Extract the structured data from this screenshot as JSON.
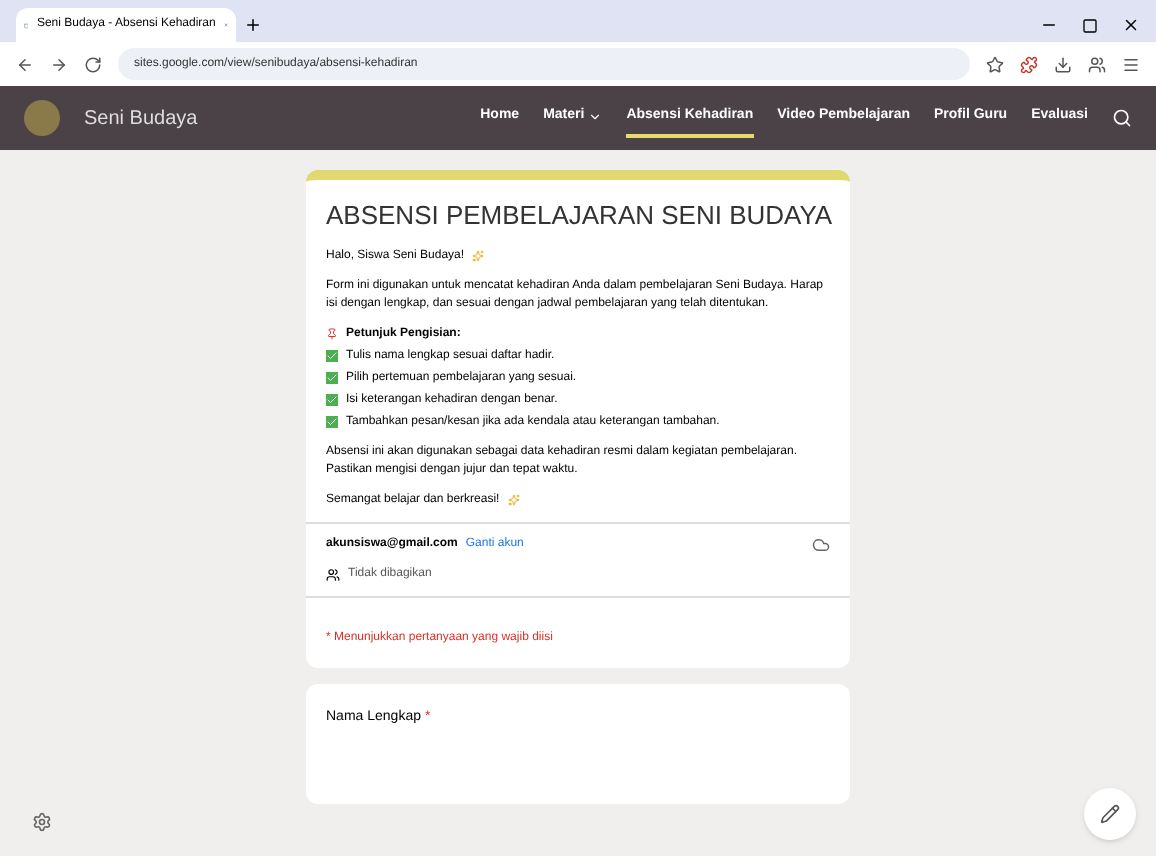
{
  "browser": {
    "tab_title": "Seni Budaya - Absensi Kehadiran",
    "url": "sites.google.com/view/senibudaya/absensi-kehadiran"
  },
  "site": {
    "name": "Seni Budaya",
    "nav": [
      {
        "label": "Home",
        "selected": false,
        "dropdown": false
      },
      {
        "label": "Materi",
        "selected": false,
        "dropdown": true
      },
      {
        "label": "Absensi Kehadiran",
        "selected": true,
        "dropdown": false
      },
      {
        "label": "Video Pembelajaran",
        "selected": false,
        "dropdown": false
      },
      {
        "label": "Profil Guru",
        "selected": false,
        "dropdown": false
      },
      {
        "label": "Evaluasi",
        "selected": false,
        "dropdown": false
      }
    ]
  },
  "form": {
    "title": "ABSENSI PEMBELAJARAN SENI BUDAYA",
    "greeting": "Halo, Siswa Seni Budaya!",
    "intro": "Form ini digunakan untuk mencatat kehadiran Anda dalam pembelajaran Seni Budaya. Harap isi dengan lengkap, dan sesuai dengan jadwal pembelajaran yang telah ditentukan.",
    "instructions_title": "Petunjuk Pengisian:",
    "instructions": [
      "Tulis nama lengkap sesuai daftar hadir.",
      "Pilih pertemuan pembelajaran yang sesuai.",
      "Isi keterangan kehadiran dengan benar.",
      "Tambahkan pesan/kesan jika ada kendala atau keterangan tambahan."
    ],
    "note": "Absensi ini akan digunakan sebagai data kehadiran resmi dalam kegiatan pembelajaran. Pastikan mengisi dengan jujur dan tepat waktu.",
    "closing": "Semangat belajar dan berkreasi!",
    "account": "akunsiswa@gmail.com",
    "switch_account": "Ganti akun",
    "not_shared": "Tidak dibagikan",
    "required_note": "* Menunjukkan pertanyaan yang wajib diisi"
  },
  "question": {
    "label": "Nama Lengkap",
    "required": true,
    "required_mark": "*"
  }
}
